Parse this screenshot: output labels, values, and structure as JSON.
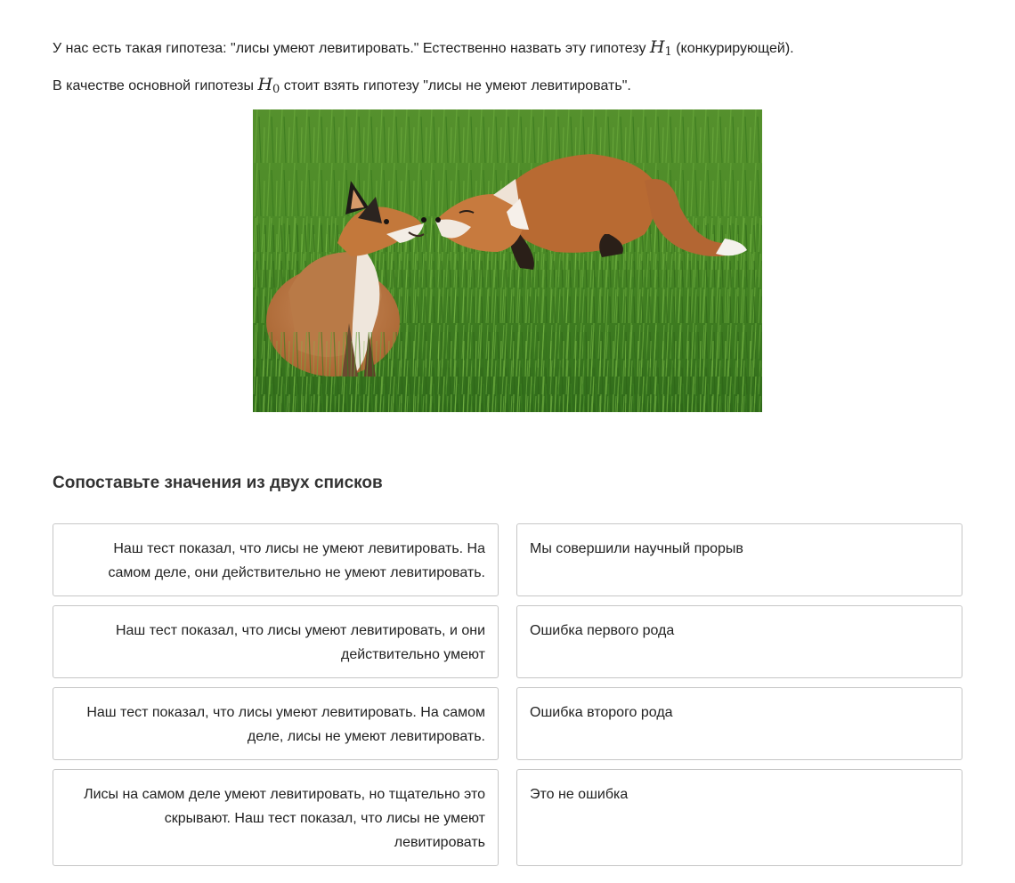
{
  "intro": {
    "line1_before": "У нас есть такая гипотеза: \"лисы умеют левитировать.\" Естественно назвать эту гипотезу ",
    "line1_symbol": "H",
    "line1_subscript": "1",
    "line1_after": " (конкурирующей).",
    "line2_before": "В качестве основной гипотезы ",
    "line2_symbol": "H",
    "line2_subscript": "0",
    "line2_after": " стоит взять гипотезу \"лисы не умеют левитировать\"."
  },
  "task": {
    "title": "Сопоставьте значения из двух списков"
  },
  "left_items": [
    {
      "text": "Наш тест показал, что лисы не умеют левитировать. На самом деле, они действительно не умеют левитировать."
    },
    {
      "text": "Наш тест показал, что лисы умеют левитировать, и они действительно умеют"
    },
    {
      "text": "Наш тест показал, что лисы умеют левитировать. На самом деле, лисы не умеют левитировать."
    },
    {
      "text": "Лисы на самом деле умеют левитировать, но тщательно это скрывают. Наш тест показал, что лисы не умеют левитировать"
    }
  ],
  "right_items": [
    {
      "text": "Мы совершили научный прорыв"
    },
    {
      "text": "Ошибка первого рода"
    },
    {
      "text": "Ошибка второго рода"
    },
    {
      "text": "Это не ошибка"
    }
  ],
  "colors": {
    "text": "#222222",
    "card_border": "#c6c6c6",
    "grass": "#3f7f24",
    "fox_fur": "#b8642a"
  }
}
